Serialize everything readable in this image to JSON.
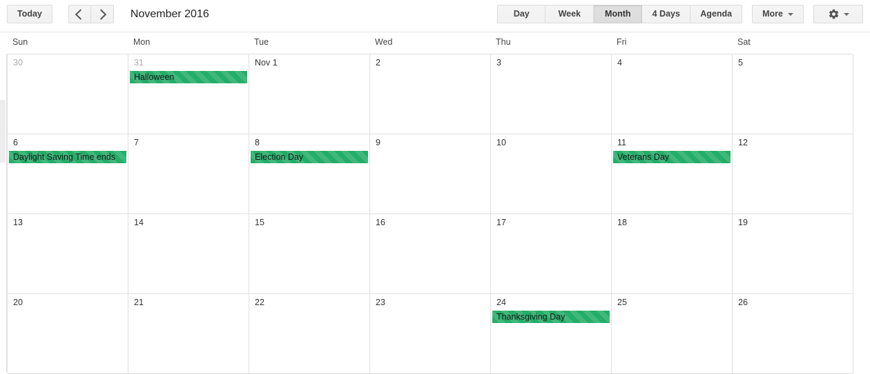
{
  "toolbar": {
    "today_label": "Today",
    "prev_label": "Previous period",
    "next_label": "Next period",
    "period_title": "November 2016",
    "views": [
      {
        "label": "Day",
        "active": false
      },
      {
        "label": "Week",
        "active": false
      },
      {
        "label": "Month",
        "active": true
      },
      {
        "label": "4 Days",
        "active": false
      },
      {
        "label": "Agenda",
        "active": false
      }
    ],
    "more_label": "More",
    "settings_label": ""
  },
  "calendar": {
    "day_names": [
      "Sun",
      "Mon",
      "Tue",
      "Wed",
      "Thu",
      "Fri",
      "Sat"
    ],
    "event_color": "#24ad68",
    "weeks": [
      {
        "days": [
          {
            "label": "30",
            "other_month": true,
            "events": []
          },
          {
            "label": "31",
            "other_month": true,
            "events": [
              {
                "title": "Halloween",
                "span": 1
              }
            ]
          },
          {
            "label": "Nov 1",
            "other_month": false,
            "events": []
          },
          {
            "label": "2",
            "other_month": false,
            "events": []
          },
          {
            "label": "3",
            "other_month": false,
            "events": []
          },
          {
            "label": "4",
            "other_month": false,
            "events": []
          },
          {
            "label": "5",
            "other_month": false,
            "events": []
          }
        ]
      },
      {
        "days": [
          {
            "label": "6",
            "other_month": false,
            "events": [
              {
                "title": "Daylight Saving Time ends",
                "span": 1
              }
            ]
          },
          {
            "label": "7",
            "other_month": false,
            "events": []
          },
          {
            "label": "8",
            "other_month": false,
            "events": [
              {
                "title": "Election Day",
                "span": 1
              }
            ]
          },
          {
            "label": "9",
            "other_month": false,
            "events": []
          },
          {
            "label": "10",
            "other_month": false,
            "events": []
          },
          {
            "label": "11",
            "other_month": false,
            "events": [
              {
                "title": "Veterans Day",
                "span": 1
              }
            ]
          },
          {
            "label": "12",
            "other_month": false,
            "events": []
          }
        ]
      },
      {
        "days": [
          {
            "label": "13",
            "other_month": false,
            "events": []
          },
          {
            "label": "14",
            "other_month": false,
            "events": []
          },
          {
            "label": "15",
            "other_month": false,
            "events": []
          },
          {
            "label": "16",
            "other_month": false,
            "events": []
          },
          {
            "label": "17",
            "other_month": false,
            "events": []
          },
          {
            "label": "18",
            "other_month": false,
            "events": []
          },
          {
            "label": "19",
            "other_month": false,
            "events": []
          }
        ]
      },
      {
        "days": [
          {
            "label": "20",
            "other_month": false,
            "events": []
          },
          {
            "label": "21",
            "other_month": false,
            "events": []
          },
          {
            "label": "22",
            "other_month": false,
            "events": []
          },
          {
            "label": "23",
            "other_month": false,
            "events": []
          },
          {
            "label": "24",
            "other_month": false,
            "events": [
              {
                "title": "Thanksgiving Day",
                "span": 1
              }
            ]
          },
          {
            "label": "25",
            "other_month": false,
            "events": []
          },
          {
            "label": "26",
            "other_month": false,
            "events": []
          }
        ]
      }
    ]
  }
}
